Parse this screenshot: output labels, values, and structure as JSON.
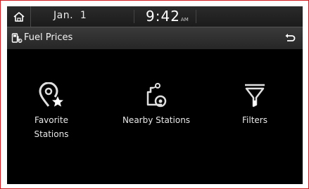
{
  "status_bar": {
    "date": "Jan.  1",
    "time": "9:42",
    "ampm": "AM"
  },
  "title_bar": {
    "title": "Fuel Prices"
  },
  "menu": {
    "items": [
      {
        "label_line1": "Favorite",
        "label_line2": "Stations",
        "icon": "favorite-location-icon"
      },
      {
        "label_line1": "Nearby Stations",
        "label_line2": "",
        "icon": "nearby-stations-icon"
      },
      {
        "label_line1": "Filters",
        "label_line2": "",
        "icon": "filter-funnel-icon"
      }
    ]
  },
  "colors": {
    "frame_border": "#d21d23",
    "screen_bg": "#000000",
    "icon_color": "#e0e0e0"
  }
}
